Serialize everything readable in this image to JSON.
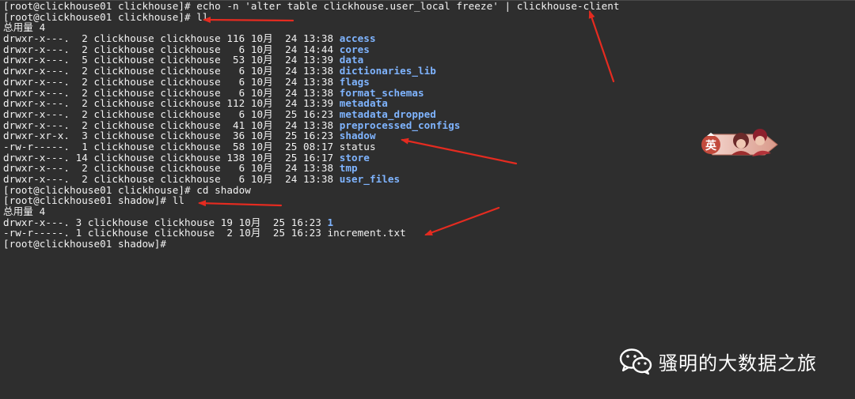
{
  "terminal": {
    "lines": [
      {
        "text": "[root@clickhouse01 clickhouse]# echo -n 'alter table clickhouse.user_local freeze' | clickhouse-client"
      },
      {
        "text": "[root@clickhouse01 clickhouse]# ll"
      },
      {
        "text": "总用量 4"
      },
      {
        "text": "drwxr-x---.  2 clickhouse clickhouse 116 10月  24 13:38 ",
        "name": "access",
        "kind": "dir"
      },
      {
        "text": "drwxr-x---.  2 clickhouse clickhouse   6 10月  24 14:44 ",
        "name": "cores",
        "kind": "dir"
      },
      {
        "text": "drwxr-x---.  5 clickhouse clickhouse  53 10月  24 13:39 ",
        "name": "data",
        "kind": "dir"
      },
      {
        "text": "drwxr-x---.  2 clickhouse clickhouse   6 10月  24 13:38 ",
        "name": "dictionaries_lib",
        "kind": "dir"
      },
      {
        "text": "drwxr-x---.  2 clickhouse clickhouse   6 10月  24 13:38 ",
        "name": "flags",
        "kind": "dir"
      },
      {
        "text": "drwxr-x---.  2 clickhouse clickhouse   6 10月  24 13:38 ",
        "name": "format_schemas",
        "kind": "dir"
      },
      {
        "text": "drwxr-x---.  2 clickhouse clickhouse 112 10月  24 13:39 ",
        "name": "metadata",
        "kind": "dir"
      },
      {
        "text": "drwxr-x---.  2 clickhouse clickhouse   6 10月  25 16:23 ",
        "name": "metadata_dropped",
        "kind": "dir"
      },
      {
        "text": "drwxr-x---.  2 clickhouse clickhouse  41 10月  24 13:38 ",
        "name": "preprocessed_configs",
        "kind": "dir"
      },
      {
        "text": "drwxr-xr-x.  3 clickhouse clickhouse  36 10月  25 16:23 ",
        "name": "shadow",
        "kind": "dir"
      },
      {
        "text": "-rw-r-----.  1 clickhouse clickhouse  58 10月  25 08:17 ",
        "name": "status",
        "kind": "file"
      },
      {
        "text": "drwxr-x---. 14 clickhouse clickhouse 138 10月  25 16:17 ",
        "name": "store",
        "kind": "dir"
      },
      {
        "text": "drwxr-x---.  2 clickhouse clickhouse   6 10月  24 13:38 ",
        "name": "tmp",
        "kind": "dir"
      },
      {
        "text": "drwxr-x---.  2 clickhouse clickhouse   6 10月  24 13:38 ",
        "name": "user_files",
        "kind": "dir"
      },
      {
        "text": "[root@clickhouse01 clickhouse]# cd shadow"
      },
      {
        "text": "[root@clickhouse01 shadow]# ll"
      },
      {
        "text": "总用量 4"
      },
      {
        "text": "drwxr-x---. 3 clickhouse clickhouse 19 10月  25 16:23 ",
        "name": "1",
        "kind": "dir"
      },
      {
        "text": "-rw-r-----. 1 clickhouse clickhouse  2 10月  25 16:23 ",
        "name": "increment.txt",
        "kind": "file"
      },
      {
        "text": "[root@clickhouse01 shadow]#"
      }
    ]
  },
  "ime": {
    "label": "英"
  },
  "watermark": {
    "text": "骚明的大数据之旅"
  },
  "colors": {
    "background": "#2e2e2e",
    "text": "#f2f2f2",
    "directory": "#7fb4ff",
    "arrow": "#e52b20"
  }
}
